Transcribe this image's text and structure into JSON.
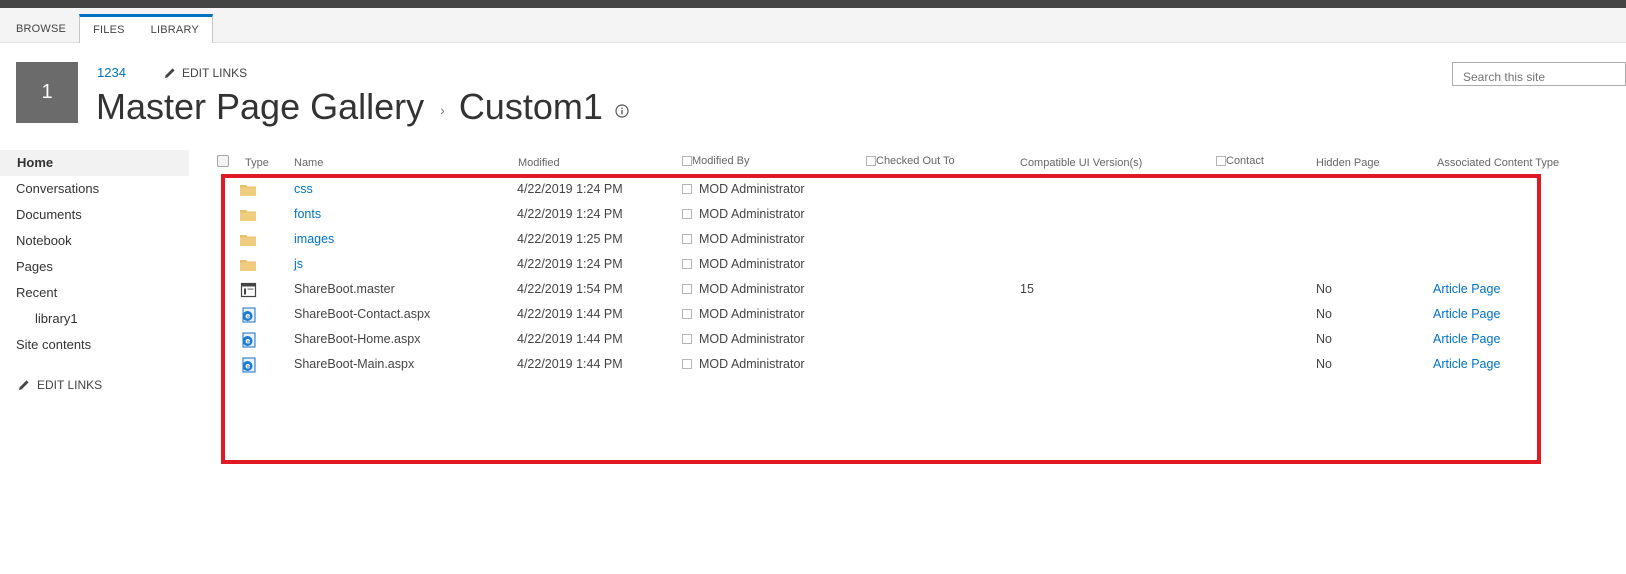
{
  "ribbon": {
    "tabs": [
      {
        "label": "BROWSE"
      },
      {
        "label": "FILES"
      },
      {
        "label": "LIBRARY"
      }
    ]
  },
  "site": {
    "logo_text": "1",
    "site_link": "1234",
    "edit_links": "EDIT LINKS"
  },
  "title": {
    "library": "Master Page Gallery",
    "separator": "›",
    "folder": "Custom1"
  },
  "search": {
    "placeholder": "Search this site"
  },
  "leftnav": {
    "items": [
      {
        "label": "Home"
      },
      {
        "label": "Conversations"
      },
      {
        "label": "Documents"
      },
      {
        "label": "Notebook"
      },
      {
        "label": "Pages"
      },
      {
        "label": "Recent"
      },
      {
        "label": "library1"
      },
      {
        "label": "Site contents"
      }
    ],
    "edit_links": "EDIT LINKS"
  },
  "list": {
    "columns": {
      "type": "Type",
      "name": "Name",
      "modified": "Modified",
      "modified_by": "Modified By",
      "checked_out_to": "Checked Out To",
      "ui_version": "Compatible UI Version(s)",
      "contact": "Contact",
      "hidden_page": "Hidden Page",
      "content_type": "Associated Content Type"
    },
    "rows": [
      {
        "icon": "folder-icon",
        "name": "css",
        "modified": "4/22/2019 1:24 PM",
        "modified_by": "MOD Administrator",
        "ui_version": "",
        "hidden": "",
        "content_type": ""
      },
      {
        "icon": "folder-icon",
        "name": "fonts",
        "modified": "4/22/2019 1:24 PM",
        "modified_by": "MOD Administrator",
        "ui_version": "",
        "hidden": "",
        "content_type": ""
      },
      {
        "icon": "folder-icon",
        "name": "images",
        "modified": "4/22/2019 1:25 PM",
        "modified_by": "MOD Administrator",
        "ui_version": "",
        "hidden": "",
        "content_type": ""
      },
      {
        "icon": "folder-icon",
        "name": "js",
        "modified": "4/22/2019 1:24 PM",
        "modified_by": "MOD Administrator",
        "ui_version": "",
        "hidden": "",
        "content_type": ""
      },
      {
        "icon": "master-page-icon",
        "name": "ShareBoot.master",
        "modified": "4/22/2019 1:54 PM",
        "modified_by": "MOD Administrator",
        "ui_version": "15",
        "hidden": "No",
        "content_type": "Article Page"
      },
      {
        "icon": "aspx-page-icon",
        "name": "ShareBoot-Contact.aspx",
        "modified": "4/22/2019 1:44 PM",
        "modified_by": "MOD Administrator",
        "ui_version": "",
        "hidden": "No",
        "content_type": "Article Page"
      },
      {
        "icon": "aspx-page-icon",
        "name": "ShareBoot-Home.aspx",
        "modified": "4/22/2019 1:44 PM",
        "modified_by": "MOD Administrator",
        "ui_version": "",
        "hidden": "No",
        "content_type": "Article Page"
      },
      {
        "icon": "aspx-page-icon",
        "name": "ShareBoot-Main.aspx",
        "modified": "4/22/2019 1:44 PM",
        "modified_by": "MOD Administrator",
        "ui_version": "",
        "hidden": "No",
        "content_type": "Article Page"
      }
    ]
  },
  "colors": {
    "link": "#0072c6",
    "highlight": "#e01a24",
    "folder": "#e8c06a",
    "logo_bg": "#6b6b6b"
  }
}
